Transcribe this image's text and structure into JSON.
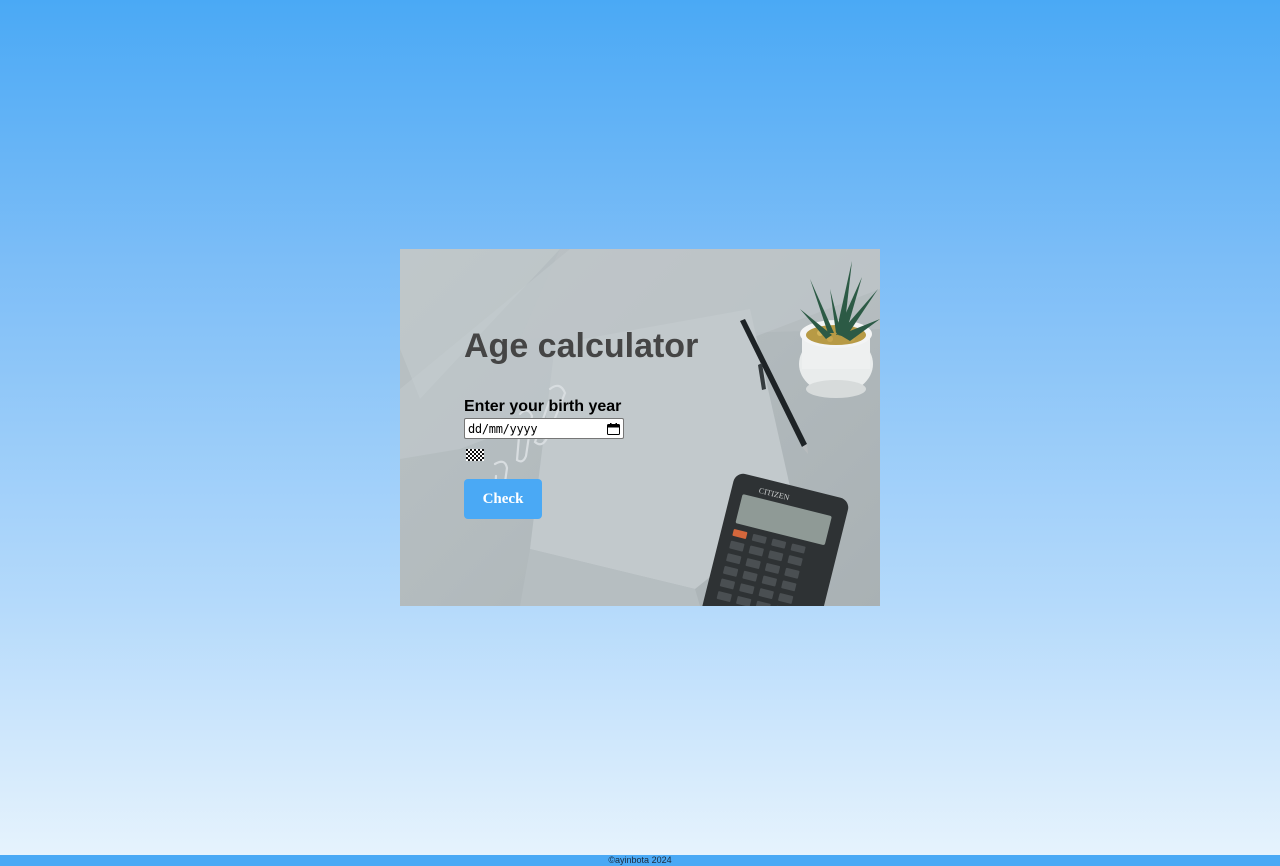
{
  "card": {
    "title": "Age calculator",
    "prompt": "Enter your birth year",
    "date_input": {
      "placeholder": "dd/mm/yyyy",
      "value": ""
    },
    "check_label": "Check",
    "calculator_brand": "CITIZEN"
  },
  "footer": {
    "text": "©ayinbota 2024"
  },
  "colors": {
    "accent": "#4aa9f5",
    "title": "#454545",
    "card_bg": "#b3bbbe"
  },
  "icons": {
    "date_picker": "calendar-icon",
    "result": "broken-image-icon"
  }
}
